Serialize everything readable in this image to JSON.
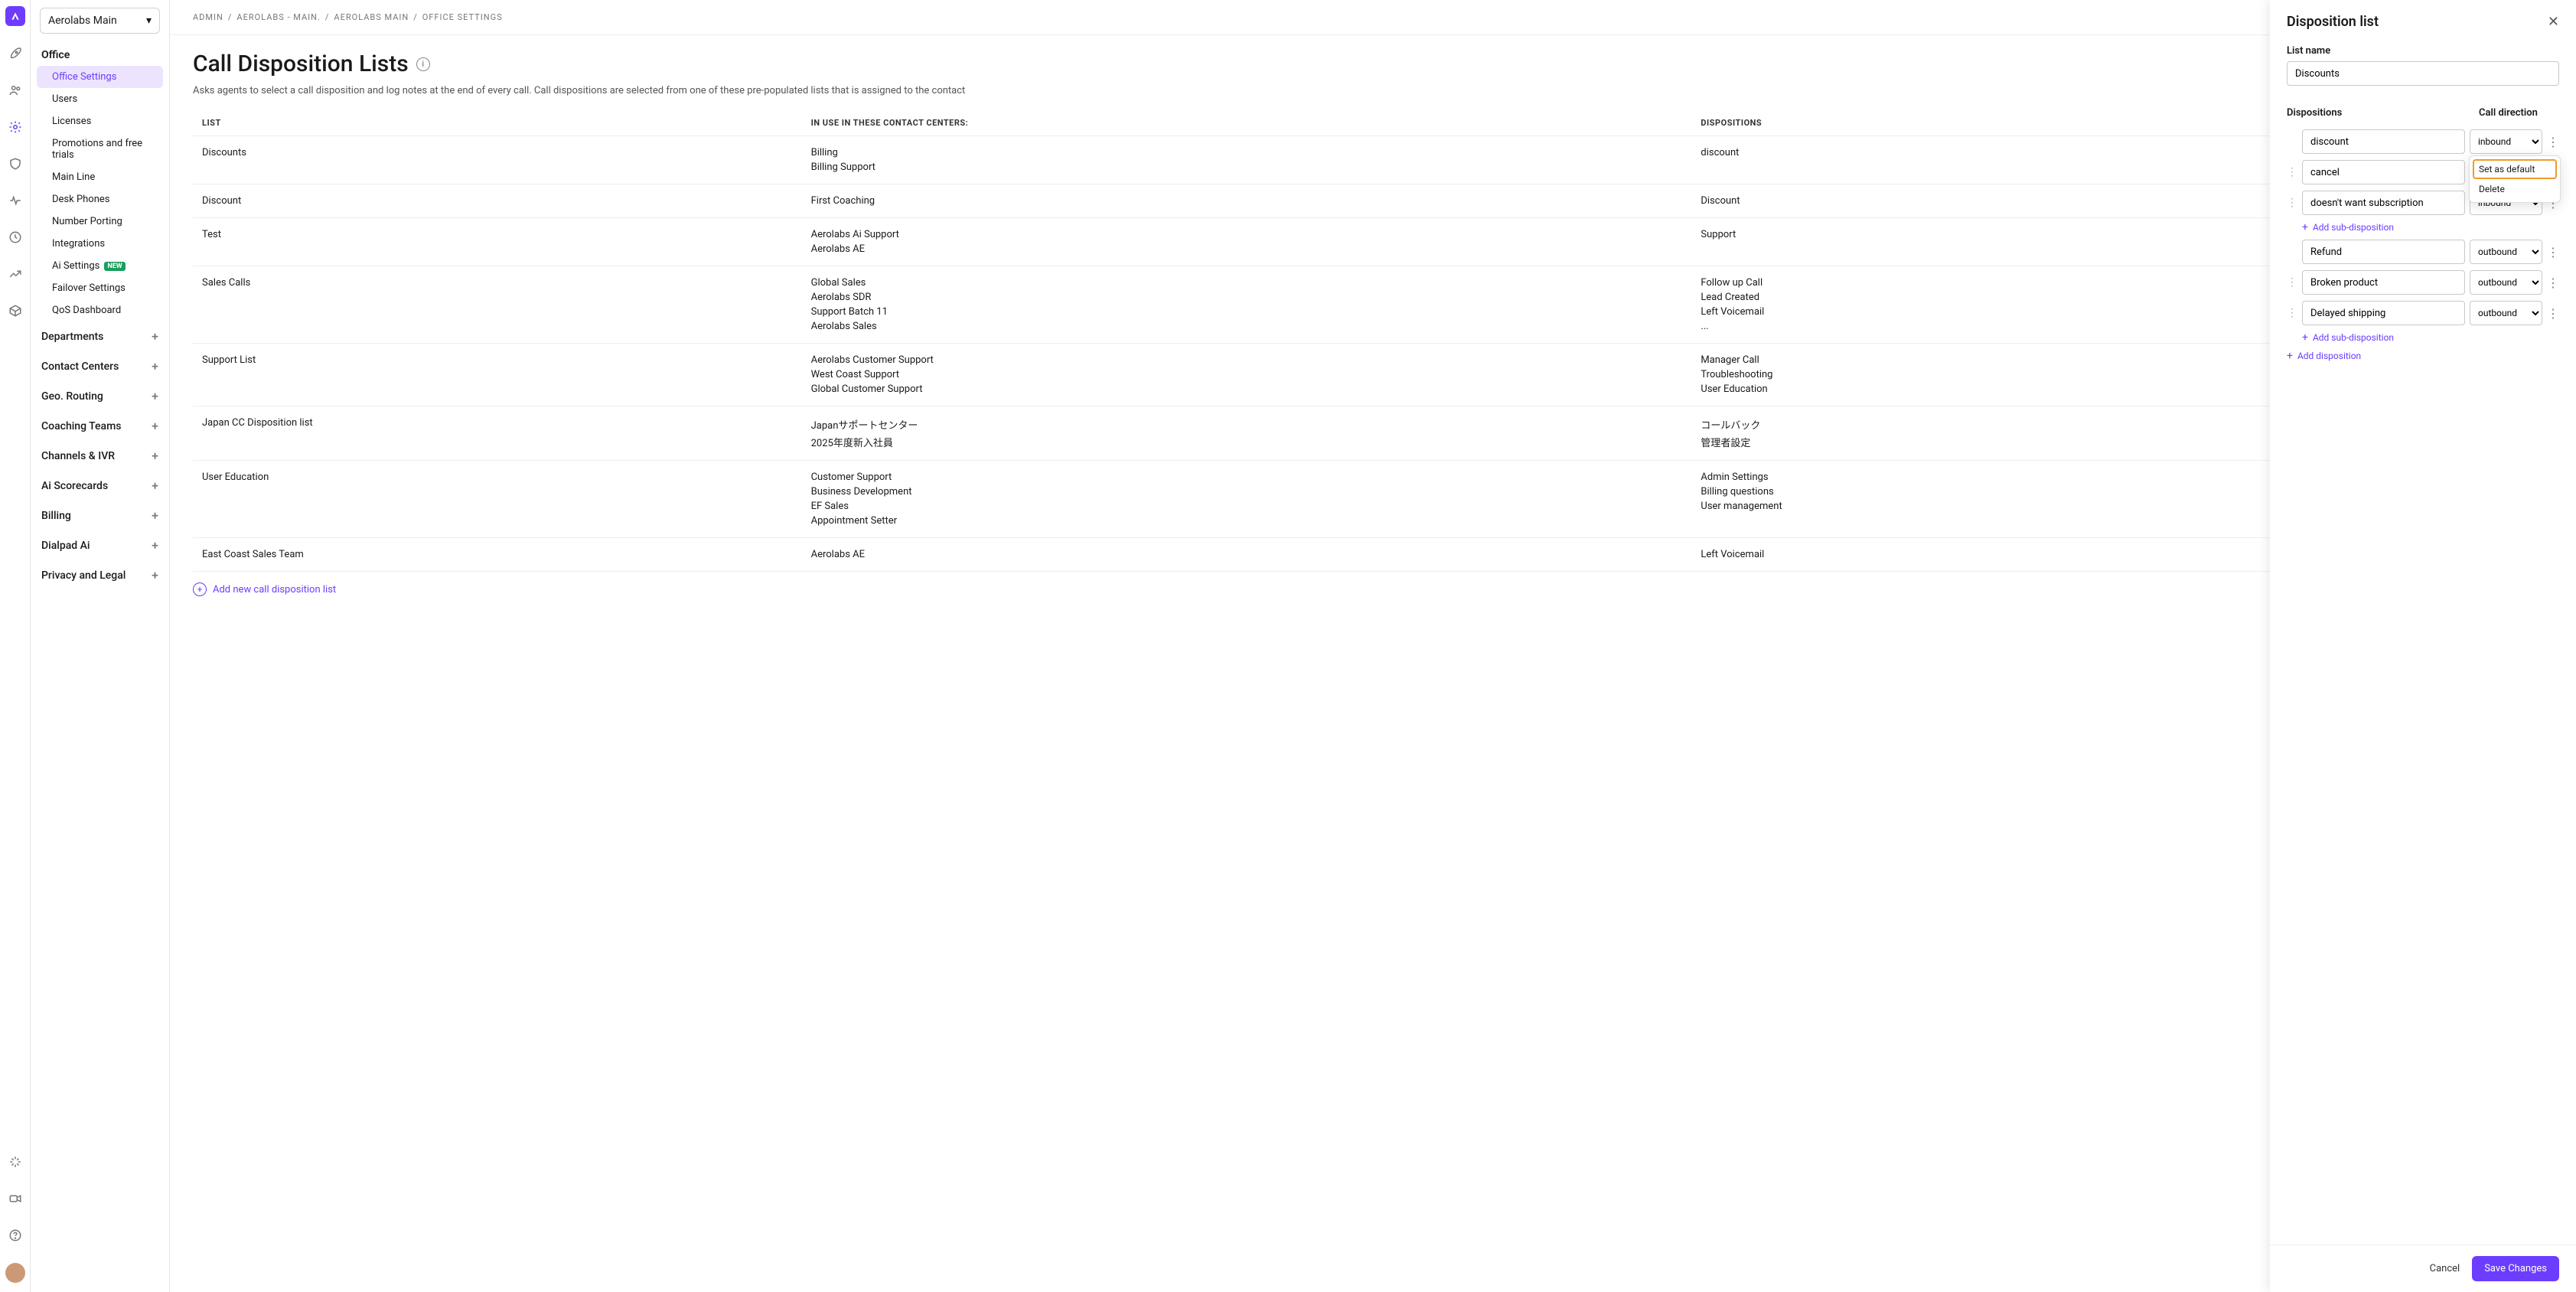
{
  "office_selector": "Aerolabs Main",
  "breadcrumb": [
    "ADMIN",
    "AEROLABS - MAIN.",
    "AEROLABS MAIN",
    "OFFICE SETTINGS"
  ],
  "page": {
    "title": "Call Disposition Lists",
    "description": "Asks agents to select a call disposition and log notes at the end of every call. Call dispositions are selected from one of these pre-populated lists that is assigned to the contact"
  },
  "sidebar": {
    "heading": "Office",
    "items": [
      {
        "label": "Office Settings",
        "active": true
      },
      {
        "label": "Users"
      },
      {
        "label": "Licenses"
      },
      {
        "label": "Promotions and free trials"
      },
      {
        "label": "Main Line"
      },
      {
        "label": "Desk Phones"
      },
      {
        "label": "Number Porting"
      },
      {
        "label": "Integrations"
      },
      {
        "label": "Ai Settings",
        "badge": "NEW"
      },
      {
        "label": "Failover Settings"
      },
      {
        "label": "QoS Dashboard"
      }
    ],
    "sections": [
      {
        "label": "Departments"
      },
      {
        "label": "Contact Centers"
      },
      {
        "label": "Geo. Routing"
      },
      {
        "label": "Coaching Teams"
      },
      {
        "label": "Channels & IVR"
      },
      {
        "label": "Ai Scorecards"
      },
      {
        "label": "Billing"
      },
      {
        "label": "Dialpad Ai"
      },
      {
        "label": "Privacy and Legal"
      }
    ]
  },
  "table": {
    "headers": {
      "list": "LIST",
      "centers": "IN USE IN THESE CONTACT CENTERS:",
      "dispositions": "DISPOSITIONS"
    },
    "rows": [
      {
        "list": "Discounts",
        "centers": [
          "Billing",
          "Billing Support"
        ],
        "dispositions": [
          "discount"
        ]
      },
      {
        "list": "Discount",
        "centers": [
          "First Coaching"
        ],
        "dispositions": [
          "Discount"
        ]
      },
      {
        "list": "Test",
        "centers": [
          "Aerolabs Ai Support",
          "Aerolabs AE"
        ],
        "dispositions": [
          "Support"
        ]
      },
      {
        "list": "Sales Calls",
        "centers": [
          "Global Sales",
          "Aerolabs SDR",
          "Support Batch 11",
          "Aerolabs Sales"
        ],
        "dispositions": [
          "Follow up Call",
          "Lead Created",
          "Left Voicemail",
          "..."
        ]
      },
      {
        "list": "Support List",
        "centers": [
          "Aerolabs Customer Support",
          "West Coast Support",
          "Global Customer Support"
        ],
        "dispositions": [
          "Manager Call",
          "Troubleshooting",
          "User Education"
        ]
      },
      {
        "list": "Japan CC Disposition list",
        "centers": [
          "Japanサポートセンター",
          "2025年度新入社員"
        ],
        "dispositions": [
          "コールバック",
          "管理者設定"
        ]
      },
      {
        "list": "User Education",
        "centers": [
          "Customer Support",
          "Business Development",
          "EF Sales",
          "Appointment Setter"
        ],
        "dispositions": [
          "Admin Settings",
          "Billing questions",
          "User management"
        ]
      },
      {
        "list": "East Coast Sales Team",
        "centers": [
          "Aerolabs AE"
        ],
        "dispositions": [
          "Left Voicemail"
        ]
      }
    ],
    "add_label": "Add new call disposition list"
  },
  "drawer": {
    "title": "Disposition list",
    "list_name_label": "List name",
    "list_name_value": "Discounts",
    "col_disp": "Dispositions",
    "col_dir": "Call direction",
    "groups": [
      {
        "parent": {
          "name": "discount",
          "dir": "inbound",
          "popup": true
        },
        "subs": [
          {
            "name": "cancel",
            "dir": ""
          },
          {
            "name": "doesn't want subscription",
            "dir": "inbound"
          }
        ]
      },
      {
        "parent": {
          "name": "Refund",
          "dir": "outbound"
        },
        "subs": [
          {
            "name": "Broken product",
            "dir": "outbound"
          },
          {
            "name": "Delayed shipping",
            "dir": "outbound"
          }
        ]
      }
    ],
    "add_sub": "Add sub-disposition",
    "add_disp": "Add disposition",
    "popup_items": [
      "Set as default",
      "Delete"
    ],
    "cancel": "Cancel",
    "save": "Save Changes"
  }
}
